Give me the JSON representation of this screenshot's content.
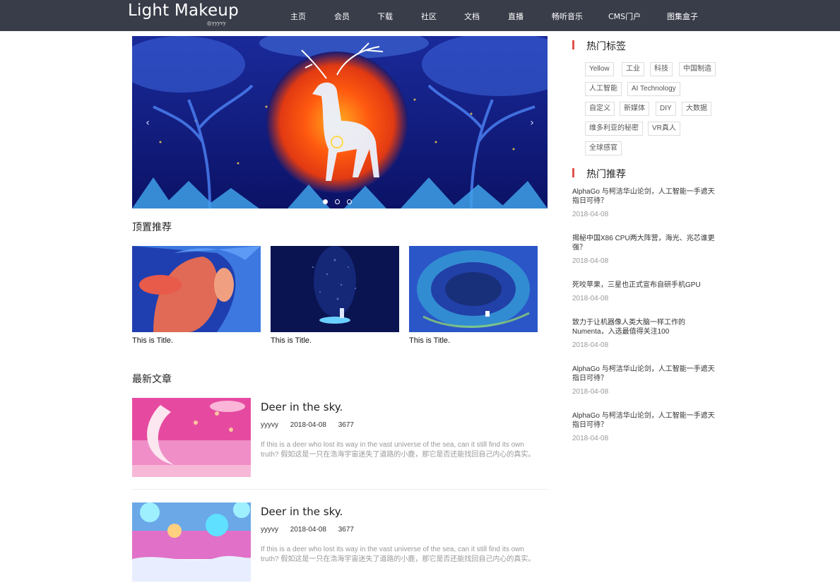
{
  "header": {
    "logo": "Light Makeup",
    "logo_sub": "@yyyvy",
    "nav": [
      "主页",
      "会员",
      "下载",
      "社区",
      "文档",
      "直播",
      "畅听音乐",
      "CMS门户",
      "图集盒子"
    ]
  },
  "carousel": {
    "prev_icon": "‹",
    "next_icon": "›",
    "dots_count": 3,
    "active_dot": 1
  },
  "top_recommend": {
    "title": "顶置推荐",
    "cards": [
      {
        "title": "This is Title."
      },
      {
        "title": "This is Title."
      },
      {
        "title": "This is Title."
      }
    ]
  },
  "latest": {
    "title": "最新文章",
    "articles": [
      {
        "title": "Deer in the sky.",
        "author": "yyyvy",
        "date": "2018-04-08",
        "views": "3677",
        "desc": "If this is a deer who lost its way in the vast universe of the sea, can it still find its own truth? 假如这是一只在浩海宇宙迷失了道路的小鹿，那它是否还能找回自己内心的真实。"
      },
      {
        "title": "Deer in the sky.",
        "author": "yyyvy",
        "date": "2018-04-08",
        "views": "3677",
        "desc": "If this is a deer who lost its way in the vast universe of the sea, can it still find its own truth? 假如这是一只在浩海宇宙迷失了道路的小鹿，那它是否还能找回自己内心的真实。"
      }
    ]
  },
  "sidebar": {
    "tags_title": "热门标签",
    "tags": [
      "Yellow",
      "工业",
      "科技",
      "中国制造",
      "人工智能",
      "AI Technology",
      "自定义",
      "新媒体",
      "DIY",
      "大数据",
      "维多利亚的秘密",
      "VR真人",
      "全球感官"
    ],
    "recommend_title": "热门推荐",
    "recommend": [
      {
        "line1": "AlphaGo 与柯洁华山论剑，人工智能一手遮天",
        "line2": "指日可待？",
        "date": "2018-04-08"
      },
      {
        "line1": "揭秘中国X86 CPU两大阵营，海光、兆芯谁更",
        "line2": "强？",
        "date": "2018-04-08"
      },
      {
        "line1": "死咬苹果，三星也正式宣布自研手机GPU",
        "line2": "",
        "date": "2018-04-08"
      },
      {
        "line1": "致力于让机器像人类大脑一样工作的",
        "line2": "Numenta，入选最值得关注100",
        "date": "2018-04-08"
      },
      {
        "line1": "AlphaGo 与柯洁华山论剑，人工智能一手遮天",
        "line2": "指日可待？",
        "date": "2018-04-08"
      },
      {
        "line1": "AlphaGo 与柯洁华山论剑，人工智能一手遮天",
        "line2": "指日可待？",
        "date": "2018-04-08"
      }
    ]
  },
  "colors": {
    "topbar": "#393d49",
    "accent": "#e0524b"
  }
}
